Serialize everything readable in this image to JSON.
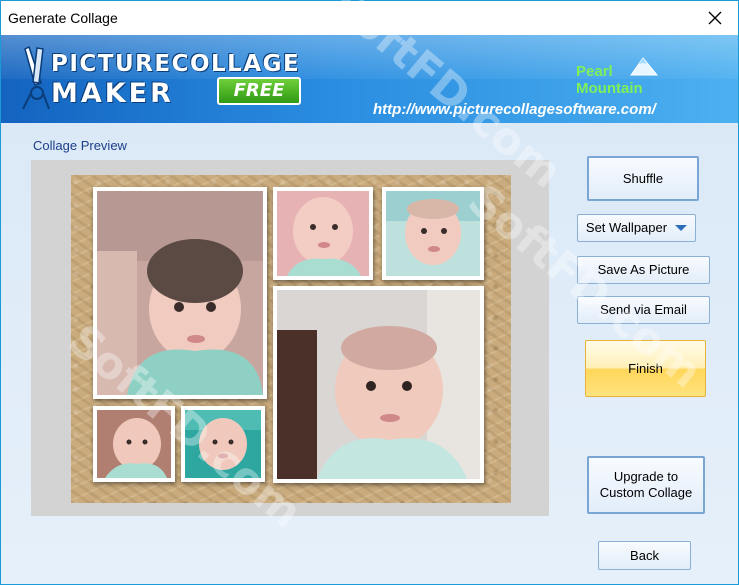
{
  "window": {
    "title": "Generate Collage"
  },
  "banner": {
    "logo_line1": "PICTURECOLLAGE",
    "logo_line2": "MAKER",
    "free_badge": "FREE",
    "url": "http://www.picturecollagesoftware.com/",
    "brand_line1": "Pearl",
    "brand_line2": "Mountain"
  },
  "preview": {
    "label": "Collage Preview"
  },
  "buttons": {
    "shuffle": "Shuffle",
    "set_wallpaper": "Set Wallpaper",
    "save_as_picture": "Save As Picture",
    "send_via_email": "Send via Email",
    "finish": "Finish",
    "upgrade": "Upgrade to Custom Collage",
    "back": "Back"
  },
  "watermark": "SoftFD.com",
  "colors": {
    "banner_dark": "#1363bf",
    "banner_light": "#4cb0f0",
    "client_bg": "#dbe9f7",
    "finish_yellow": "#ffd65a",
    "free_green": "#2f9a14"
  }
}
